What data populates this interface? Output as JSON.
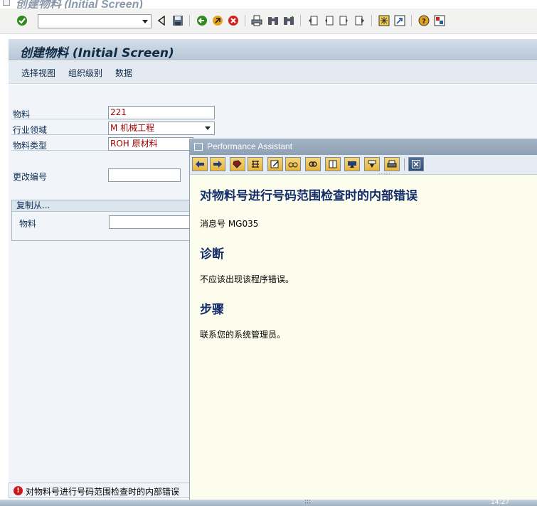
{
  "window": {
    "title": "创建物料 (Initial Screen)"
  },
  "toolbar": {
    "command_value": "",
    "icons": [
      "enter-icon",
      "back-triangle-icon",
      "save-icon",
      "back-icon",
      "exit-icon",
      "cancel-icon",
      "print-icon",
      "find-icon",
      "find-next-icon",
      "first-page-icon",
      "previous-page-icon",
      "next-page-icon",
      "last-page-icon",
      "new-session-icon",
      "shortcut-icon",
      "help-icon",
      "layout-icon"
    ]
  },
  "screen": {
    "title": "创建物料 (Initial Screen)",
    "app_toolbar": [
      "选择视图",
      "组织级别",
      "数据"
    ]
  },
  "form": {
    "material_label": "物料",
    "material_value": "221",
    "industry_label": "行业领域",
    "industry_value": "M 机械工程",
    "type_label": "物料类型",
    "type_value": "ROH 原材料",
    "change_no_label": "更改编号",
    "change_no_value": "",
    "copy_from_title": "复制从...",
    "copy_material_label": "物料",
    "copy_material_value": ""
  },
  "status": {
    "type": "error",
    "message": "对物料号进行号码范围检查时的内部错误"
  },
  "performance_assistant": {
    "title": "Performance Assistant",
    "heading": "对物料号进行号码范围检查时的内部错误",
    "message_number": "消息号  MG035",
    "diagnosis_title": "诊断",
    "diagnosis_text": "不应该出现该程序错误。",
    "procedure_title": "步骤",
    "procedure_text": "联系您的系统管理员。",
    "toolbar_icons": [
      "back-arrow-icon",
      "forward-arrow-icon",
      "bookmark-icon",
      "technical-info-icon",
      "edit-icon",
      "glasses-icon",
      "link-icon",
      "book-icon",
      "display-icon",
      "filter-icon",
      "print-icon",
      "close-icon"
    ]
  },
  "clock": "14:27"
}
